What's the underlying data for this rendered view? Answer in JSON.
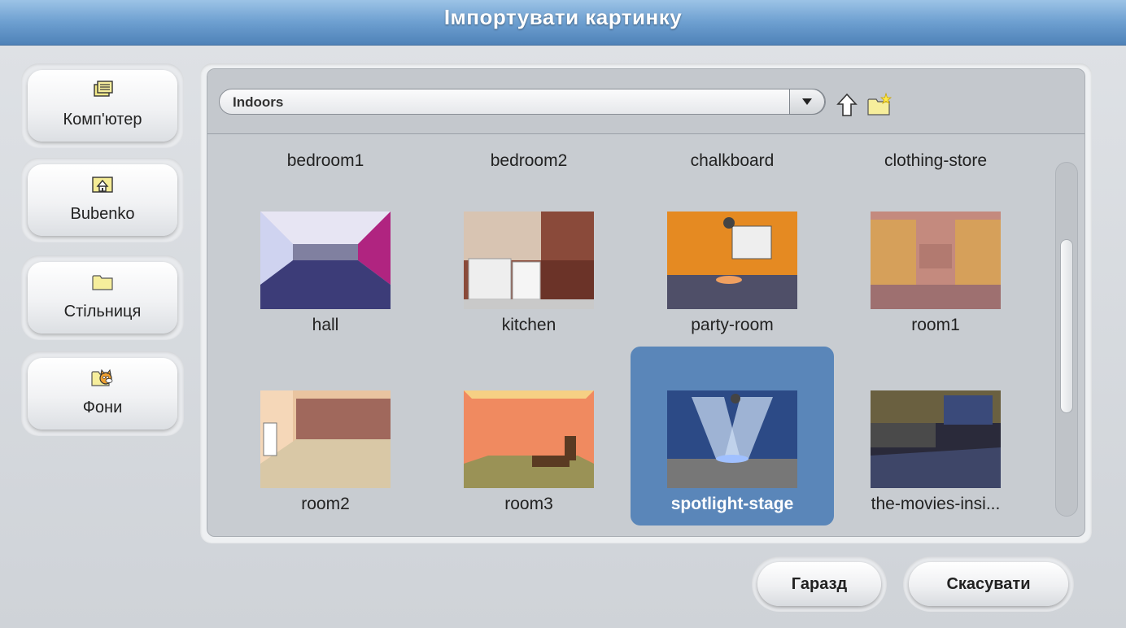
{
  "dialog": {
    "title": "Імпортувати картинку"
  },
  "sidebar": {
    "items": [
      {
        "label": "Комп'ютер",
        "icon": "computer-icon"
      },
      {
        "label": "Bubenko",
        "icon": "home-folder-icon"
      },
      {
        "label": "Стільниця",
        "icon": "folder-icon"
      },
      {
        "label": "Фони",
        "icon": "scratch-cat-folder-icon"
      }
    ]
  },
  "browser": {
    "folder": "Indoors",
    "items": [
      {
        "label": "bedroom1"
      },
      {
        "label": "bedroom2"
      },
      {
        "label": "chalkboard"
      },
      {
        "label": "clothing-store"
      },
      {
        "label": "hall"
      },
      {
        "label": "kitchen"
      },
      {
        "label": "party-room"
      },
      {
        "label": "room1"
      },
      {
        "label": "room2"
      },
      {
        "label": "room3"
      },
      {
        "label": "spotlight-stage"
      },
      {
        "label": "the-movies-insi..."
      }
    ],
    "selected": "spotlight-stage"
  },
  "buttons": {
    "ok": "Гаразд",
    "cancel": "Скасувати"
  },
  "colors": {
    "title_bar": "#6d9fd0",
    "selection": "#5a86b9"
  }
}
